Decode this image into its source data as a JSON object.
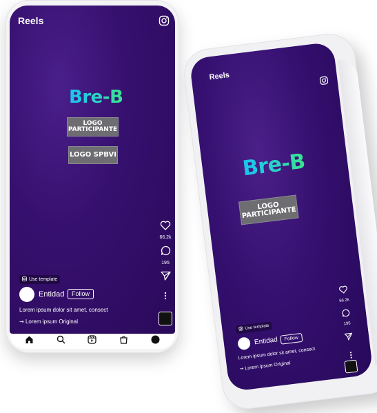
{
  "phone_front": {
    "header": {
      "title": "Reels",
      "camera_icon": "camera-icon"
    },
    "brand": {
      "logo_text": "Bre-B"
    },
    "boxes": {
      "participant_line1": "LOGO",
      "participant_line2": "PARTICIPANTE",
      "spbvi": "LOGO SPBVI"
    },
    "actions": {
      "likes": "66.2k",
      "comments": "195"
    },
    "use_template": "Use template",
    "entity_name": "Entidad",
    "follow_label": "Follow",
    "caption": "Lorem ipsum dolor sit amet, consect",
    "audio": "Lorem ipsum Original",
    "nav": [
      "home-icon",
      "search-icon",
      "reels-icon",
      "shop-icon",
      "profile-icon"
    ]
  },
  "phone_back": {
    "header": {
      "title": "Reels",
      "camera_icon": "camera-icon"
    },
    "brand": {
      "logo_text": "Bre-B"
    },
    "boxes": {
      "participant_line1": "LOGO",
      "participant_line2": "PARTICIPANTE"
    },
    "actions": {
      "likes": "66.2k",
      "comments": "195"
    },
    "use_template": "Use template",
    "entity_name": "Entidad",
    "follow_label": "Follow",
    "caption": "Lorem ipsum dolor sit amet, consect",
    "audio": "Lorem ipsum Original"
  },
  "colors": {
    "screen_purple": "#37106f",
    "logo_cyan": "#19c3f0",
    "logo_green": "#3ae38e",
    "box_grey": "#6e6e72"
  }
}
